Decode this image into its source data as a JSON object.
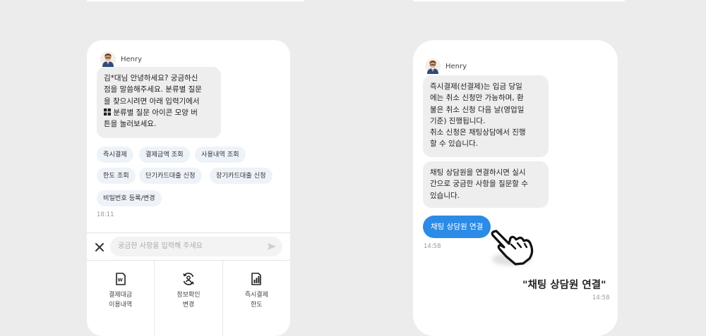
{
  "left": {
    "agent_name": "Henry",
    "greeting_before_icon": "김*대님 안녕하세요? 궁금하신\n점을 말씀해주세요. 분류별 질문\n을 찾으시려면 아래 입력기에서\n",
    "greeting_after_icon": " 분류별 질문 아이콘 모양 버\n튼을 눌러보세요.",
    "chips": [
      "즉시결제",
      "결제금액 조회",
      "사용내역 조회",
      "한도 조회",
      "단기카드대출 신청",
      "장기카드대출 신청",
      "비밀번호 등록/변경"
    ],
    "time": "18:11",
    "input_placeholder": "궁금한 사항을 입력해 주세요",
    "menu": [
      {
        "label": "결제대금\n이용내역",
        "icon": "card-statement-icon"
      },
      {
        "label": "정보확인\n변경",
        "icon": "user-refresh-icon"
      },
      {
        "label": "즉시결제\n한도",
        "icon": "payment-limit-icon"
      }
    ]
  },
  "right": {
    "agent_name": "Henry",
    "message1": "즉시결제(선결제)는 입금 당일\n에는 취소 신청만 가능하며, 환\n불은 취소 신청 다음 날(영업일\n기준) 진행됩니다.\n취소 신청은 채팅상담에서 진행\n할 수 있습니다.",
    "message2": "채팅 상담원을 연결하시면 실시\n간으로 궁금한 사항을 질문할 수\n있습니다.",
    "button_label": "채팅 상담원 연결",
    "time_msg": "14:58",
    "caption": "\"채팅 상담원 연결\"",
    "time_caption": "14:58"
  },
  "colors": {
    "accent": "#2b8be6",
    "chip_bg": "#eef2f9",
    "bubble_bg": "#eeeeee",
    "page_bg": "#ececec"
  }
}
